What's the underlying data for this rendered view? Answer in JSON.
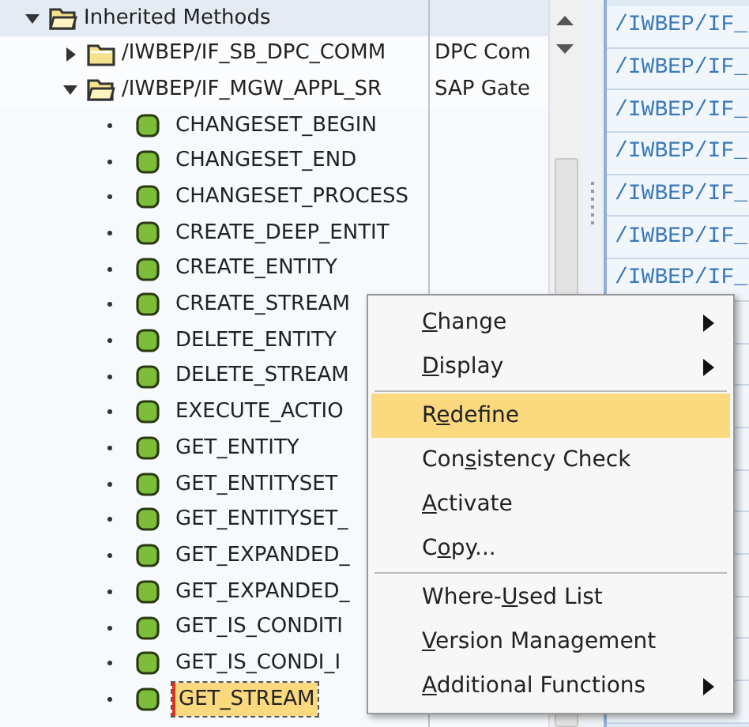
{
  "tree": {
    "items": [
      {
        "kind": "folder",
        "label": "Inherited Methods",
        "expanded": true,
        "children": [
          {
            "kind": "folder",
            "label": "/IWBEP/IF_SB_DPC_COMM",
            "description": "DPC Com",
            "expanded": false
          },
          {
            "kind": "folder",
            "label": "/IWBEP/IF_MGW_APPL_SR",
            "description": "SAP Gate",
            "expanded": true,
            "children": [
              {
                "kind": "method",
                "label": "CHANGESET_BEGIN",
                "selected": false
              },
              {
                "kind": "method",
                "label": "CHANGESET_END",
                "selected": false
              },
              {
                "kind": "method",
                "label": "CHANGESET_PROCESS",
                "selected": false
              },
              {
                "kind": "method",
                "label": "CREATE_DEEP_ENTIT",
                "selected": false
              },
              {
                "kind": "method",
                "label": "CREATE_ENTITY",
                "selected": false
              },
              {
                "kind": "method",
                "label": "CREATE_STREAM",
                "selected": false
              },
              {
                "kind": "method",
                "label": "DELETE_ENTITY",
                "selected": false
              },
              {
                "kind": "method",
                "label": "DELETE_STREAM",
                "selected": false
              },
              {
                "kind": "method",
                "label": "EXECUTE_ACTIO",
                "selected": false
              },
              {
                "kind": "method",
                "label": "GET_ENTITY",
                "selected": false
              },
              {
                "kind": "method",
                "label": "GET_ENTITYSET",
                "selected": false
              },
              {
                "kind": "method",
                "label": "GET_ENTITYSET_",
                "selected": false
              },
              {
                "kind": "method",
                "label": "GET_EXPANDED_",
                "selected": false
              },
              {
                "kind": "method",
                "label": "GET_EXPANDED_",
                "selected": false
              },
              {
                "kind": "method",
                "label": "GET_IS_CONDITI",
                "selected": false
              },
              {
                "kind": "method",
                "label": "GET_IS_CONDI_I",
                "selected": false
              },
              {
                "kind": "method",
                "label": "GET_STREAM",
                "selected": true
              }
            ]
          }
        ]
      }
    ]
  },
  "right_panel": {
    "rows": [
      "/IWBEP/IF_",
      "/IWBEP/IF_",
      "/IWBEP/IF_",
      "/IWBEP/IF_",
      "/IWBEP/IF_",
      "/IWBEP/IF_",
      "/IWBEP/IF_"
    ]
  },
  "context_menu": {
    "items": [
      {
        "kind": "item",
        "key": "C",
        "post": "hange",
        "submenu": true,
        "selected": false
      },
      {
        "kind": "item",
        "key": "D",
        "post": "isplay",
        "submenu": true,
        "selected": false
      },
      {
        "kind": "separator"
      },
      {
        "kind": "item",
        "pre": "R",
        "key": "e",
        "post": "define",
        "submenu": false,
        "selected": true
      },
      {
        "kind": "item",
        "pre": "Con",
        "key": "s",
        "post": "istency Check",
        "submenu": false,
        "selected": false
      },
      {
        "kind": "item",
        "key": "A",
        "post": "ctivate",
        "submenu": false,
        "selected": false
      },
      {
        "kind": "item",
        "pre": "C",
        "key": "o",
        "post": "py...",
        "submenu": false,
        "selected": false
      },
      {
        "kind": "separator"
      },
      {
        "kind": "item",
        "pre": "Where-",
        "key": "U",
        "post": "sed List",
        "submenu": false,
        "selected": false
      },
      {
        "kind": "item",
        "key": "V",
        "post": "ersion Management",
        "submenu": false,
        "selected": false
      },
      {
        "kind": "item",
        "key": "A",
        "post": "dditional Functions",
        "submenu": true,
        "selected": false
      }
    ]
  }
}
